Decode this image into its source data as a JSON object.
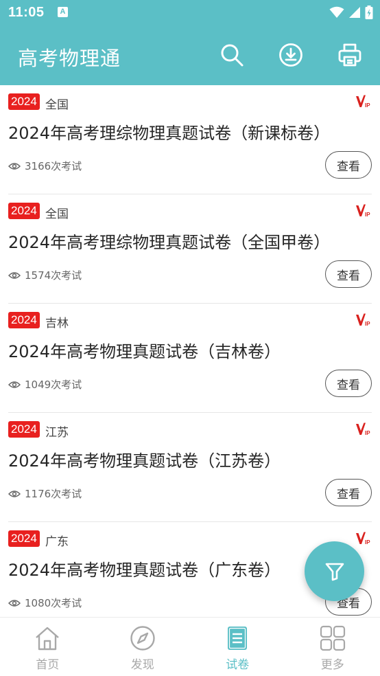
{
  "status_bar": {
    "time": "11:05",
    "notification_letter": "A"
  },
  "app_bar": {
    "title": "高考物理通",
    "actions": [
      "search-icon",
      "download-icon",
      "print-icon"
    ]
  },
  "colors": {
    "primary": "#5bbfc6",
    "badge": "#e8201f",
    "vip": "#d9211e"
  },
  "papers": [
    {
      "year": "2024",
      "region": "全国",
      "title": "2024年高考理综物理真题试卷（新课标卷）",
      "views": "3166次考试",
      "button": "查看",
      "vip": true
    },
    {
      "year": "2024",
      "region": "全国",
      "title": "2024年高考理综物理真题试卷（全国甲卷）",
      "views": "1574次考试",
      "button": "查看",
      "vip": true
    },
    {
      "year": "2024",
      "region": "吉林",
      "title": "2024年高考物理真题试卷（吉林卷）",
      "views": "1049次考试",
      "button": "查看",
      "vip": true
    },
    {
      "year": "2024",
      "region": "江苏",
      "title": "2024年高考物理真题试卷（江苏卷）",
      "views": "1176次考试",
      "button": "查看",
      "vip": true
    },
    {
      "year": "2024",
      "region": "广东",
      "title": "2024年高考物理真题试卷（广东卷）",
      "views": "1080次考试",
      "button": "查看",
      "vip": true
    }
  ],
  "fab": {
    "icon": "filter-icon"
  },
  "bottom_nav": {
    "items": [
      {
        "label": "首页",
        "icon": "home-icon",
        "active": false
      },
      {
        "label": "发现",
        "icon": "compass-icon",
        "active": false
      },
      {
        "label": "试卷",
        "icon": "document-icon",
        "active": true
      },
      {
        "label": "更多",
        "icon": "grid-icon",
        "active": false
      }
    ]
  }
}
